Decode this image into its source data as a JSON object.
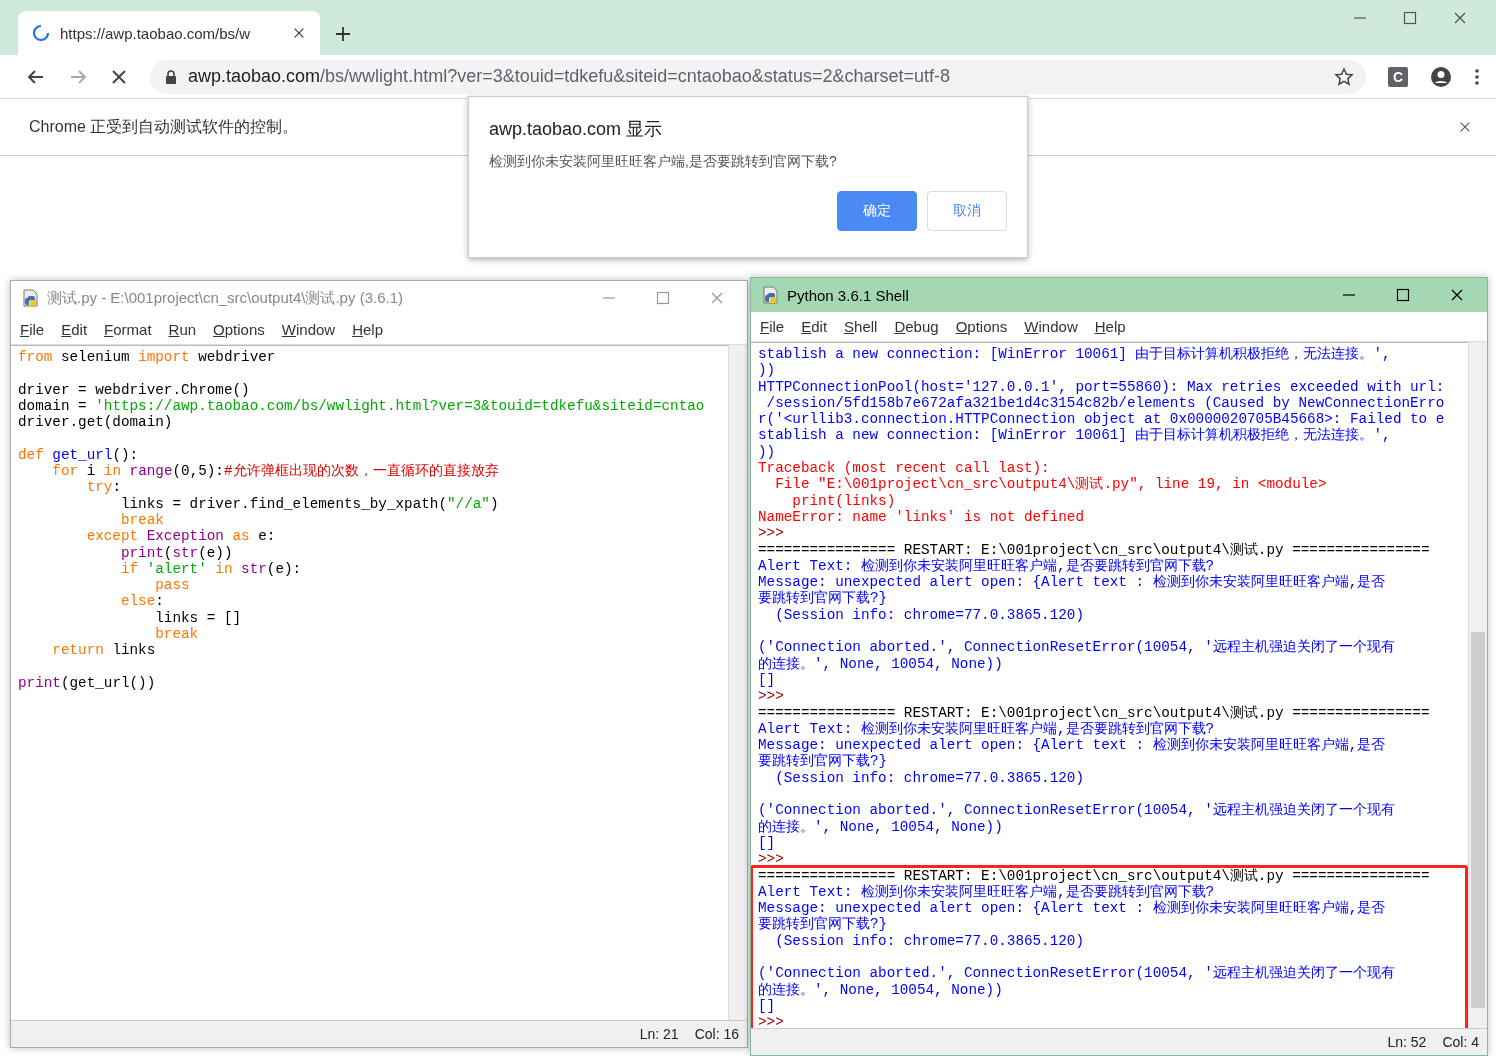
{
  "browser": {
    "tab": {
      "title": "https://awp.taobao.com/bs/w",
      "loading": true
    },
    "address": {
      "host": "awp.taobao.com",
      "path": "/bs/wwlight.html?ver=3&touid=tdkefu&siteid=cntaobao&status=2&charset=utf-8"
    },
    "extension_badge": "C",
    "infobar": "Chrome 正受到自动测试软件的控制。"
  },
  "dialog": {
    "title": "awp.taobao.com 显示",
    "message": "检测到你未安装阿里旺旺客户端,是否要跳转到官网下载?",
    "buttons": [
      {
        "label": "确定",
        "primary": true
      },
      {
        "label": "取消",
        "primary": false
      }
    ]
  },
  "editor": {
    "title": "测试.py - E:\\001project\\cn_src\\output4\\测试.py (3.6.1)",
    "active": false,
    "menu": [
      "File",
      "Edit",
      "Format",
      "Run",
      "Options",
      "Window",
      "Help"
    ],
    "lines": [
      {
        "kind": "code",
        "tokens": [
          {
            "text": "from",
            "kind": "keyword"
          },
          {
            "text": " selenium ",
            "kind": "plain"
          },
          {
            "text": "import",
            "kind": "keyword"
          },
          {
            "text": " webdriver",
            "kind": "plain"
          }
        ]
      },
      {
        "kind": "blank"
      },
      {
        "kind": "code",
        "tokens": [
          {
            "text": "driver = webdriver.Chrome()",
            "kind": "plain"
          }
        ]
      },
      {
        "kind": "code",
        "tokens": [
          {
            "text": "domain = ",
            "kind": "plain"
          },
          {
            "text": "'https://awp.taobao.com/bs/wwlight.html?ver=3&touid=tdkefu&siteid=cntao",
            "kind": "string"
          }
        ]
      },
      {
        "kind": "code",
        "tokens": [
          {
            "text": "driver.get(domain)",
            "kind": "plain"
          }
        ]
      },
      {
        "kind": "blank"
      },
      {
        "kind": "code",
        "tokens": [
          {
            "text": "def",
            "kind": "keyword"
          },
          {
            "text": " get_url",
            "kind": "definition"
          },
          {
            "text": "():",
            "kind": "plain"
          }
        ]
      },
      {
        "kind": "code",
        "tokens": [
          {
            "text": "    for",
            "kind": "keyword"
          },
          {
            "text": " i ",
            "kind": "plain"
          },
          {
            "text": "in",
            "kind": "keyword"
          },
          {
            "text": " range",
            "kind": "builtin"
          },
          {
            "text": "(0,5):",
            "kind": "plain"
          },
          {
            "text": "#允许弹框出现的次数，一直循环的直接放弃",
            "kind": "comment"
          }
        ]
      },
      {
        "kind": "code",
        "tokens": [
          {
            "text": "        try",
            "kind": "keyword"
          },
          {
            "text": ":",
            "kind": "plain"
          }
        ]
      },
      {
        "kind": "code",
        "tokens": [
          {
            "text": "            links = driver.find_elements_by_xpath(",
            "kind": "plain"
          },
          {
            "text": "\"//a\"",
            "kind": "string"
          },
          {
            "text": ")",
            "kind": "plain"
          }
        ]
      },
      {
        "kind": "code",
        "tokens": [
          {
            "text": "            break",
            "kind": "keyword"
          }
        ]
      },
      {
        "kind": "code",
        "tokens": [
          {
            "text": "        except",
            "kind": "keyword"
          },
          {
            "text": " Exception",
            "kind": "builtin"
          },
          {
            "text": " as",
            "kind": "keyword"
          },
          {
            "text": " e:",
            "kind": "plain"
          }
        ]
      },
      {
        "kind": "code",
        "tokens": [
          {
            "text": "            print",
            "kind": "builtin"
          },
          {
            "text": "(",
            "kind": "plain"
          },
          {
            "text": "str",
            "kind": "builtin"
          },
          {
            "text": "(e))",
            "kind": "plain"
          }
        ]
      },
      {
        "kind": "code",
        "tokens": [
          {
            "text": "            if",
            "kind": "keyword"
          },
          {
            "text": " 'alert'",
            "kind": "string"
          },
          {
            "text": " in",
            "kind": "keyword"
          },
          {
            "text": " str",
            "kind": "builtin"
          },
          {
            "text": "(e):",
            "kind": "plain"
          }
        ]
      },
      {
        "kind": "code",
        "tokens": [
          {
            "text": "                pass",
            "kind": "keyword"
          }
        ]
      },
      {
        "kind": "code",
        "tokens": [
          {
            "text": "            else",
            "kind": "keyword"
          },
          {
            "text": ":",
            "kind": "plain"
          }
        ]
      },
      {
        "kind": "code",
        "tokens": [
          {
            "text": "                links = []",
            "kind": "plain"
          }
        ]
      },
      {
        "kind": "code",
        "tokens": [
          {
            "text": "                break",
            "kind": "keyword"
          }
        ]
      },
      {
        "kind": "code",
        "tokens": [
          {
            "text": "    return",
            "kind": "keyword"
          },
          {
            "text": " links",
            "kind": "plain"
          }
        ]
      },
      {
        "kind": "blank"
      },
      {
        "kind": "code",
        "tokens": [
          {
            "text": "print",
            "kind": "builtin"
          },
          {
            "text": "(get_url())",
            "kind": "plain"
          }
        ]
      }
    ],
    "status": {
      "line": "Ln: 21",
      "col": "Col: 16"
    }
  },
  "shell": {
    "title": "Python 3.6.1 Shell",
    "active": true,
    "menu": [
      "File",
      "Edit",
      "Shell",
      "Debug",
      "Options",
      "Window",
      "Help"
    ],
    "lines": [
      {
        "kind": "output",
        "text": "stablish a new connection: [WinError 10061] 由于目标计算机积极拒绝，无法连接。',"
      },
      {
        "kind": "output",
        "text": "))"
      },
      {
        "kind": "output",
        "text": "HTTPConnectionPool(host='127.0.0.1', port=55860): Max retries exceeded with url:"
      },
      {
        "kind": "output",
        "text": " /session/5fd158b7e672afa321be1d4c3154c82b/elements (Caused by NewConnectionErro"
      },
      {
        "kind": "output",
        "text": "r('<urllib3.connection.HTTPConnection object at 0x0000020705B45668>: Failed to e"
      },
      {
        "kind": "output",
        "text": "stablish a new connection: [WinError 10061] 由于目标计算机积极拒绝，无法连接。',"
      },
      {
        "kind": "output",
        "text": "))"
      },
      {
        "kind": "error",
        "text": "Traceback (most recent call last):"
      },
      {
        "kind": "error",
        "text": "  File \"E:\\001project\\cn_src\\output4\\测试.py\", line 19, in <module>"
      },
      {
        "kind": "error",
        "text": "    print(links)"
      },
      {
        "kind": "error",
        "text": "NameError: name 'links' is not defined"
      },
      {
        "kind": "prompt",
        "text": ">>>"
      },
      {
        "kind": "restart",
        "text": "================ RESTART: E:\\001project\\cn_src\\output4\\测试.py ================"
      },
      {
        "kind": "output",
        "text": "Alert Text: 检测到你未安装阿里旺旺客户端,是否要跳转到官网下载?"
      },
      {
        "kind": "output",
        "text": "Message: unexpected alert open: {Alert text : 检测到你未安装阿里旺旺客户端,是否"
      },
      {
        "kind": "output",
        "text": "要跳转到官网下载?}"
      },
      {
        "kind": "output",
        "text": "  (Session info: chrome=77.0.3865.120)"
      },
      {
        "kind": "blank"
      },
      {
        "kind": "output",
        "text": "('Connection aborted.', ConnectionResetError(10054, '远程主机强迫关闭了一个现有"
      },
      {
        "kind": "output",
        "text": "的连接。', None, 10054, None))"
      },
      {
        "kind": "output",
        "text": "[]"
      },
      {
        "kind": "prompt",
        "text": ">>>"
      },
      {
        "kind": "restart",
        "text": "================ RESTART: E:\\001project\\cn_src\\output4\\测试.py ================"
      },
      {
        "kind": "output",
        "text": "Alert Text: 检测到你未安装阿里旺旺客户端,是否要跳转到官网下载?"
      },
      {
        "kind": "output",
        "text": "Message: unexpected alert open: {Alert text : 检测到你未安装阿里旺旺客户端,是否"
      },
      {
        "kind": "output",
        "text": "要跳转到官网下载?}"
      },
      {
        "kind": "output",
        "text": "  (Session info: chrome=77.0.3865.120)"
      },
      {
        "kind": "blank"
      },
      {
        "kind": "output",
        "text": "('Connection aborted.', ConnectionResetError(10054, '远程主机强迫关闭了一个现有"
      },
      {
        "kind": "output",
        "text": "的连接。', None, 10054, None))"
      },
      {
        "kind": "output",
        "text": "[]"
      },
      {
        "kind": "prompt",
        "text": ">>>"
      }
    ],
    "highlight_box": {
      "lines": [
        {
          "kind": "restart",
          "text": "================ RESTART: E:\\001project\\cn_src\\output4\\测试.py ================"
        },
        {
          "kind": "output",
          "text": "Alert Text: 检测到你未安装阿里旺旺客户端,是否要跳转到官网下载?"
        },
        {
          "kind": "output",
          "text": "Message: unexpected alert open: {Alert text : 检测到你未安装阿里旺旺客户端,是否"
        },
        {
          "kind": "output",
          "text": "要跳转到官网下载?}"
        },
        {
          "kind": "output",
          "text": "  (Session info: chrome=77.0.3865.120)"
        },
        {
          "kind": "blank"
        },
        {
          "kind": "output",
          "text": "('Connection aborted.', ConnectionResetError(10054, '远程主机强迫关闭了一个现有"
        },
        {
          "kind": "output",
          "text": "的连接。', None, 10054, None))"
        },
        {
          "kind": "output",
          "text": "[]"
        },
        {
          "kind": "prompt",
          "text": ">>>"
        }
      ]
    },
    "status": {
      "line": "Ln: 52",
      "col": "Col: 4"
    }
  }
}
